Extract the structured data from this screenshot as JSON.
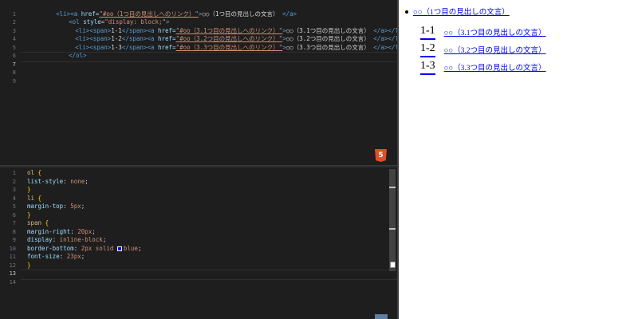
{
  "html_editor": {
    "lines": [
      {
        "n": "1"
      },
      {
        "n": "2"
      },
      {
        "n": "3"
      },
      {
        "n": "4"
      },
      {
        "n": "5"
      },
      {
        "n": "6"
      },
      {
        "n": "7"
      },
      {
        "n": "8"
      },
      {
        "n": "9"
      }
    ],
    "code": {
      "li_open": "<li>",
      "a_open": "<a ",
      "href_attr": "href=",
      "href_top": "\"#oo（1つ目の見出しへのリンク）\"",
      "gt": ">",
      "top_text": "○○（1つ目の見出しの文言）",
      "a_close": "</a>",
      "ol_open": "<ol ",
      "style_attr": "style=",
      "style_val": "\"display: block;\"",
      "span_open": "<span>",
      "span_close": "</span>",
      "li_close": "</li>",
      "ol_close": "</ol>",
      "rows": [
        {
          "num": "1-1",
          "href": "\"#oo（3.1つ目の見出しへのリンク）\"",
          "text": "○○（3.1つ目の見出しの文言）"
        },
        {
          "num": "1-2",
          "href": "\"#oo（3.2つ目の見出しへのリンク）\"",
          "text": "○○（3.2つ目の見出しの文言）"
        },
        {
          "num": "1-3",
          "href": "\"#oo（3.3つ目の見出しへのリンク）\"",
          "text": "○○（3.3つ目の見出しの文言）"
        }
      ]
    }
  },
  "css_editor": {
    "lines": [
      "1",
      "2",
      "3",
      "4",
      "5",
      "6",
      "7",
      "8",
      "9",
      "10",
      "11",
      "12",
      "13",
      "14"
    ],
    "code": [
      {
        "sel": "ol",
        "brace": " {"
      },
      {
        "prop": "list-style",
        "val": "none"
      },
      {
        "brace": "}"
      },
      {
        "sel": "li",
        "brace": " {"
      },
      {
        "prop": "margin-top",
        "val": "5px"
      },
      {
        "brace": "}"
      },
      {
        "sel": "span",
        "brace": " {"
      },
      {
        "prop": "margin-right",
        "val": "20px"
      },
      {
        "prop": "display",
        "val": "inline-block"
      },
      {
        "prop": "border-bottom",
        "val": "2px solid ",
        "val2": "blue"
      },
      {
        "prop": "font-size",
        "val": "23px"
      },
      {
        "brace": "}"
      }
    ]
  },
  "badge_label": "5",
  "colors": {
    "editor_bg": "#1e1e1e",
    "tag": "#569cd6",
    "attr": "#9cdcfe",
    "string": "#ce9178",
    "link": "#0000ee",
    "underline": "blue"
  },
  "preview": {
    "top_link": "○○（1つ目の見出しの文言）",
    "items": [
      {
        "num": "1-1",
        "link": "○○（3.1つ目の見出しの文言）"
      },
      {
        "num": "1-2",
        "link": "○○（3.2つ目の見出しの文言）"
      },
      {
        "num": "1-3",
        "link": "○○（3.3つ目の見出しの文言）"
      }
    ]
  }
}
